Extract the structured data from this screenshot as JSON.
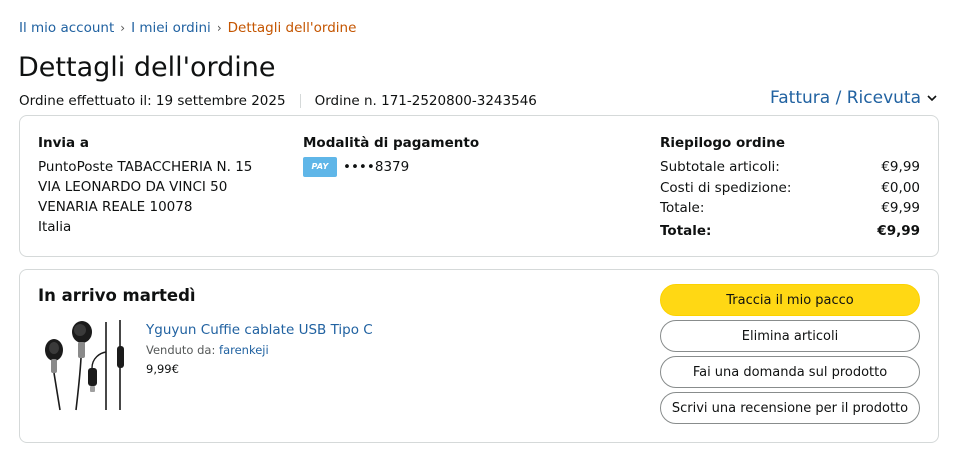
{
  "breadcrumb": {
    "items": [
      "Il mio account",
      "I miei ordini"
    ],
    "current": "Dettagli dell'ordine",
    "separator": "›"
  },
  "page_title": "Dettagli dell'ordine",
  "order_meta": {
    "placed": "Ordine effettuato il: 19 settembre 2025",
    "number": "Ordine n. 171-2520800-3243546"
  },
  "invoice_link": "Fattura / Ricevuta",
  "shipping": {
    "heading": "Invia a",
    "lines": [
      "PuntoPoste TABACCHERIA N. 15",
      "VIA LEONARDO DA VINCI 50",
      "VENARIA REALE 10078",
      "Italia"
    ]
  },
  "payment": {
    "heading": "Modalità di pagamento",
    "card_label": "PAY",
    "card_masked": "••••8379"
  },
  "summary": {
    "heading": "Riepilogo ordine",
    "rows": [
      {
        "label": "Subtotale articoli:",
        "value": "€9,99"
      },
      {
        "label": "Costi di spedizione:",
        "value": "€0,00"
      },
      {
        "label": "Totale:",
        "value": "€9,99"
      }
    ],
    "grand_total": {
      "label": "Totale:",
      "value": "€9,99"
    }
  },
  "shipment": {
    "arrival": "In arrivo martedì",
    "product": {
      "title": "Yguyun Cuffie cablate USB Tipo C",
      "sold_by_label": "Venduto da:",
      "seller": "farenkeji",
      "price": "9,99€"
    },
    "buttons": {
      "track": "Traccia il mio pacco",
      "remove": "Elimina articoli",
      "ask": "Fai una domanda sul prodotto",
      "review": "Scrivi una recensione per il prodotto"
    }
  },
  "colors": {
    "link": "#2162a1",
    "breadcrumb_current": "#c45500",
    "primary_button": "#ffd814",
    "border": "#d5d9d9"
  },
  "icons": {
    "invoice_chevron": "chevron-down-icon",
    "card": "card-brand-icon",
    "product": "earphones-image"
  }
}
